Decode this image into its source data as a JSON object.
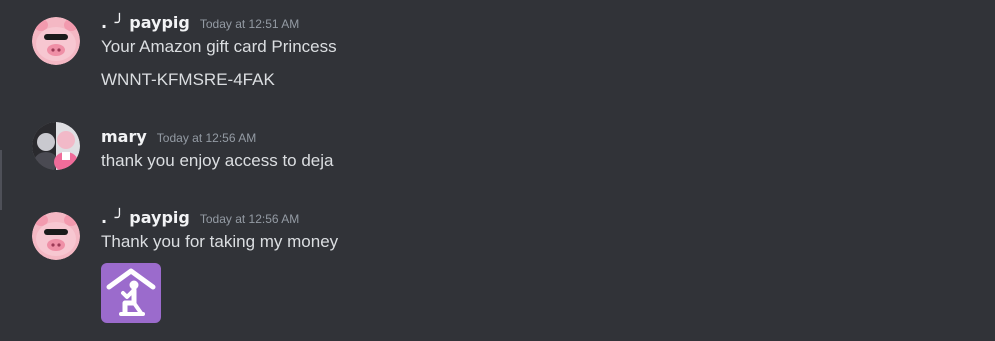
{
  "messages": [
    {
      "username_prefix": ". ╯",
      "username": "paypig",
      "timestamp": "Today at 12:51 AM",
      "lines": [
        "Your Amazon gift card Princess",
        "WNNT-KFMSRE-4FAK"
      ],
      "avatar_icon": "pig-avatar-icon"
    },
    {
      "username": "mary",
      "timestamp": "Today at 12:56 AM",
      "lines": [
        "thank you enjoy access to deja"
      ],
      "avatar_icon": "photo-avatar-icon"
    },
    {
      "username_prefix": ". ╯",
      "username": "paypig",
      "timestamp": "Today at 12:56 AM",
      "lines": [
        "Thank you for taking my money"
      ],
      "avatar_icon": "pig-avatar-icon",
      "emoji": "place-of-worship-emoji-icon"
    }
  ],
  "colors": {
    "background": "#313338",
    "username": "#f2f3f5",
    "timestamp": "#949ba4",
    "text": "#dbdee1",
    "emoji_bg": "#9b6bcc"
  }
}
